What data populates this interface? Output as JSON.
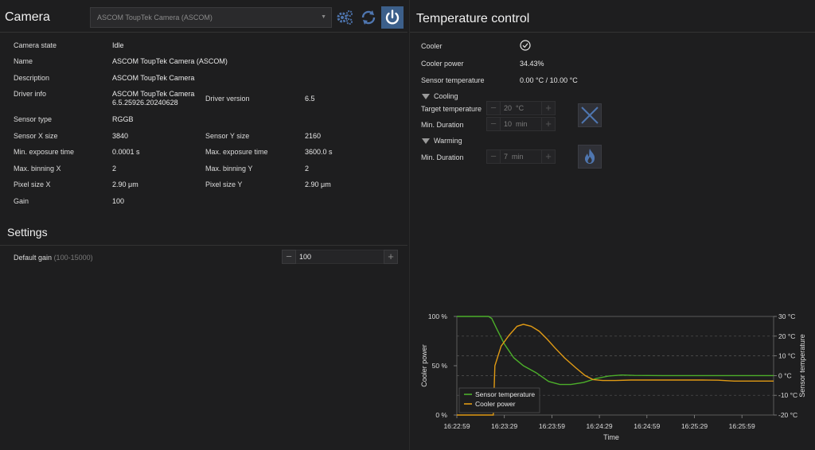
{
  "camera": {
    "title": "Camera",
    "selected_device": "ASCOM ToupTek Camera (ASCOM)",
    "properties": [
      {
        "label": "Camera state",
        "value": "Idle"
      },
      {
        "label": "Name",
        "value": "ASCOM ToupTek Camera (ASCOM)"
      },
      {
        "label": "Description",
        "value": "ASCOM ToupTek Camera"
      },
      {
        "label": "Driver info",
        "value_line1": "ASCOM ToupTek Camera",
        "value_line2": "6.5.25926.20240628",
        "label2": "Driver version",
        "value2": "6.5"
      },
      {
        "label": "Sensor type",
        "value": "RGGB"
      },
      {
        "label": "Sensor X size",
        "value": "3840",
        "label2": "Sensor Y size",
        "value2": "2160"
      },
      {
        "label": "Min. exposure time",
        "value": "0.0001 s",
        "label2": "Max. exposure time",
        "value2": "3600.0 s"
      },
      {
        "label": "Max. binning X",
        "value": "2",
        "label2": "Max. binning Y",
        "value2": "2"
      },
      {
        "label": "Pixel size X",
        "value": "2.90 μm",
        "label2": "Pixel size Y",
        "value2": "2.90 μm"
      },
      {
        "label": "Gain",
        "value": "100"
      }
    ]
  },
  "settings": {
    "title": "Settings",
    "default_gain_label": "Default gain",
    "default_gain_range": "(100-15000)",
    "default_gain_value": "100"
  },
  "temperature": {
    "title": "Temperature control",
    "cooler_label": "Cooler",
    "cooler_power_label": "Cooler power",
    "cooler_power_value": "34.43%",
    "sensor_temp_label": "Sensor temperature",
    "sensor_temp_value": "0.00 °C /  10.00 °C",
    "cooling_label": "Cooling",
    "target_temp_label": "Target temperature",
    "target_temp_value": "20",
    "target_temp_unit": "°C",
    "cool_duration_label": "Min. Duration",
    "cool_duration_value": "10",
    "cool_duration_unit": "min",
    "warming_label": "Warming",
    "warm_duration_label": "Min. Duration",
    "warm_duration_value": "7",
    "warm_duration_unit": "min"
  },
  "colors": {
    "sensor_temperature": "#4caf2a",
    "cooler_power": "#e09a14",
    "accent": "#3c5f8a"
  },
  "chart_data": {
    "type": "line",
    "xlabel": "Time",
    "ylabel_left": "Cooler power",
    "ylabel_right": "Sensor temperature",
    "x_ticks": [
      "16:22:59",
      "16:23:29",
      "16:23:59",
      "16:24:29",
      "16:24:59",
      "16:25:29",
      "16:25:59"
    ],
    "y_left_ticks": [
      "100 %",
      "50 %",
      "0 %"
    ],
    "y_right_ticks": [
      "30 °C",
      "20 °C",
      "10 °C",
      "0 °C",
      "-10 °C",
      "-20 °C"
    ],
    "x_seconds_range": [
      0,
      200
    ],
    "ylim_left": [
      0,
      100
    ],
    "ylim_right": [
      -20,
      30
    ],
    "grid": true,
    "legend_position": "bottom-left",
    "series": [
      {
        "name": "Sensor temperature",
        "axis": "right",
        "points": [
          [
            0,
            30
          ],
          [
            20,
            30
          ],
          [
            22,
            29
          ],
          [
            25,
            24
          ],
          [
            30,
            16
          ],
          [
            36,
            9
          ],
          [
            42,
            5
          ],
          [
            50,
            1.5
          ],
          [
            58,
            -3
          ],
          [
            65,
            -4.5
          ],
          [
            72,
            -4.5
          ],
          [
            80,
            -3.5
          ],
          [
            88,
            -1.5
          ],
          [
            96,
            -0.2
          ],
          [
            104,
            0.3
          ],
          [
            112,
            0.1
          ],
          [
            130,
            0
          ],
          [
            150,
            0
          ],
          [
            170,
            0
          ],
          [
            185,
            0
          ],
          [
            200,
            0
          ]
        ]
      },
      {
        "name": "Cooler power",
        "axis": "left",
        "points": [
          [
            0,
            0
          ],
          [
            20,
            0
          ],
          [
            23,
            0
          ],
          [
            24,
            50
          ],
          [
            28,
            70
          ],
          [
            33,
            81
          ],
          [
            38,
            90
          ],
          [
            42,
            92
          ],
          [
            47,
            90
          ],
          [
            52,
            85
          ],
          [
            57,
            77
          ],
          [
            62,
            68
          ],
          [
            68,
            58
          ],
          [
            75,
            48
          ],
          [
            81,
            40
          ],
          [
            86,
            36
          ],
          [
            92,
            35
          ],
          [
            100,
            35
          ],
          [
            110,
            35.5
          ],
          [
            125,
            35.5
          ],
          [
            140,
            35.5
          ],
          [
            155,
            35.5
          ],
          [
            165,
            35.3
          ],
          [
            175,
            34.4
          ],
          [
            190,
            34.4
          ],
          [
            200,
            34.4
          ]
        ]
      }
    ]
  }
}
